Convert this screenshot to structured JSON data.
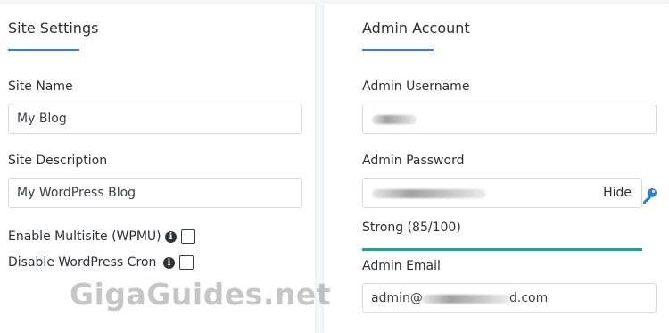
{
  "site_settings": {
    "title": "Site Settings",
    "site_name_label": "Site Name",
    "site_name_value": "My Blog",
    "site_description_label": "Site Description",
    "site_description_value": "My WordPress Blog",
    "multisite_label": "Enable Multisite (WPMU)",
    "multisite_checked": false,
    "disable_cron_label": "Disable WordPress Cron",
    "disable_cron_checked": false
  },
  "admin_account": {
    "title": "Admin Account",
    "username_label": "Admin Username",
    "password_label": "Admin Password",
    "hide_label": "Hide",
    "strength_text": "Strong (85/100)",
    "strength_value": 85,
    "email_label": "Admin Email",
    "email_prefix": "admin@",
    "email_suffix": "d.com"
  },
  "watermark": "GigaGuides.net",
  "colors": {
    "accent": "#2f80ed",
    "strength_bar": "#17a29a",
    "key_icon": "#2a7fd6"
  }
}
